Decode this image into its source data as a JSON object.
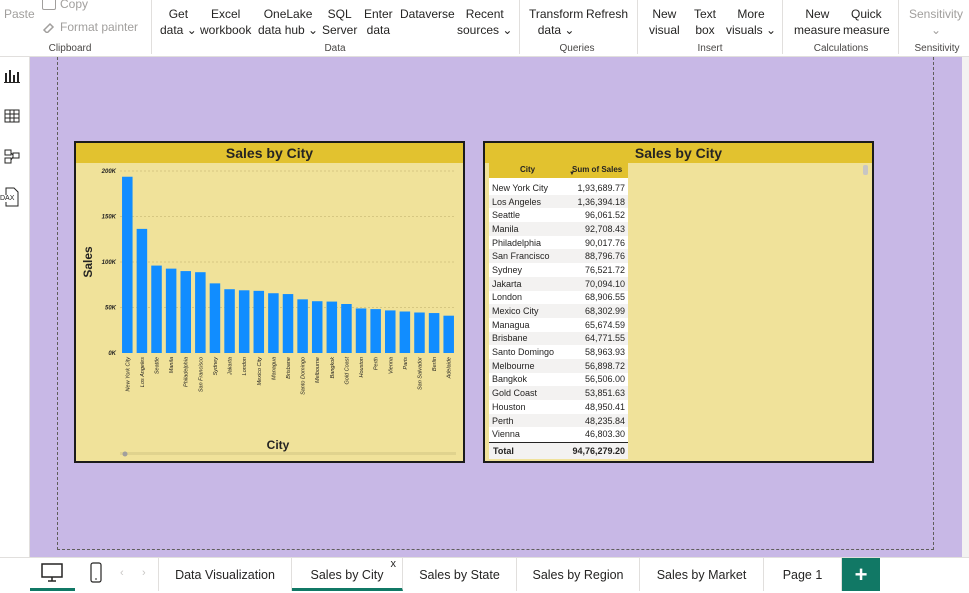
{
  "ribbon": {
    "clipboard": {
      "paste": "Paste",
      "copy": "Copy",
      "format_painter": "Format painter",
      "group": "Clipboard"
    },
    "data": {
      "get_data": [
        "Get",
        "data"
      ],
      "excel": [
        "Excel",
        "workbook"
      ],
      "onelake": [
        "OneLake",
        "data hub"
      ],
      "sql": [
        "SQL",
        "Server"
      ],
      "enter_data": [
        "Enter",
        "data"
      ],
      "dataverse": "Dataverse",
      "recent": [
        "Recent",
        "sources"
      ],
      "group": "Data"
    },
    "queries": {
      "transform": [
        "Transform",
        "data"
      ],
      "refresh": "Refresh",
      "group": "Queries"
    },
    "insert": {
      "new_visual": [
        "New",
        "visual"
      ],
      "text_box": [
        "Text",
        "box"
      ],
      "more_visuals": [
        "More",
        "visuals"
      ],
      "group": "Insert"
    },
    "calculations": {
      "new_measure": [
        "New",
        "measure"
      ],
      "quick_measure": [
        "Quick",
        "measure"
      ],
      "group": "Calculations"
    },
    "sensitivity": {
      "label": "Sensitivity",
      "group": "Sensitivity"
    }
  },
  "left_rail": {
    "icons": [
      "report-view-icon",
      "table-view-icon",
      "model-view-icon",
      "dax-query-icon"
    ],
    "dax_label": "DAX"
  },
  "bar_visual": {
    "title": "Sales by City",
    "chart_data": {
      "type": "bar",
      "title": "Sales by City",
      "xlabel": "City",
      "ylabel": "Sales",
      "ylim": [
        0,
        200000
      ],
      "yticks": [
        "0K",
        "50K",
        "100K",
        "150K",
        "200K"
      ],
      "categories": [
        "New York City",
        "Los Angeles",
        "Seattle",
        "Manila",
        "Philadelphia",
        "San Francisco",
        "Sydney",
        "Jakarta",
        "London",
        "Mexico City",
        "Managua",
        "Brisbane",
        "Santo Domingo",
        "Melbourne",
        "Bangkok",
        "Gold Coast",
        "Houston",
        "Perth",
        "Vienna",
        "Paris",
        "San Salvador",
        "Berlin",
        "Adelaide"
      ],
      "values": [
        193689.77,
        136394.18,
        96061.52,
        92708.43,
        90017.76,
        88796.76,
        76521.72,
        70094.1,
        68906.55,
        68302.99,
        65674.59,
        64771.55,
        58963.93,
        56898.72,
        56506.0,
        53851.63,
        48950.41,
        48235.84,
        46803.3,
        45600.0,
        44500.0,
        43900.0,
        41000.0
      ],
      "bar_color": "#118dff",
      "grid": true
    }
  },
  "table_visual": {
    "title": "Sales by City",
    "headers": [
      "City",
      "Sum of Sales"
    ],
    "rows": [
      [
        "New York City",
        "1,93,689.77"
      ],
      [
        "Los Angeles",
        "1,36,394.18"
      ],
      [
        "Seattle",
        "96,061.52"
      ],
      [
        "Manila",
        "92,708.43"
      ],
      [
        "Philadelphia",
        "90,017.76"
      ],
      [
        "San Francisco",
        "88,796.76"
      ],
      [
        "Sydney",
        "76,521.72"
      ],
      [
        "Jakarta",
        "70,094.10"
      ],
      [
        "London",
        "68,906.55"
      ],
      [
        "Mexico City",
        "68,302.99"
      ],
      [
        "Managua",
        "65,674.59"
      ],
      [
        "Brisbane",
        "64,771.55"
      ],
      [
        "Santo Domingo",
        "58,963.93"
      ],
      [
        "Melbourne",
        "56,898.72"
      ],
      [
        "Bangkok",
        "56,506.00"
      ],
      [
        "Gold Coast",
        "53,851.63"
      ],
      [
        "Houston",
        "48,950.41"
      ],
      [
        "Perth",
        "48,235.84"
      ],
      [
        "Vienna",
        "46,803.30"
      ]
    ],
    "total_label": "Total",
    "total_value": "94,76,279.20"
  },
  "tabs": [
    {
      "label": "Data Visualization",
      "active": false
    },
    {
      "label": "Sales by City",
      "active": true
    },
    {
      "label": "Sales by State",
      "active": false
    },
    {
      "label": "Sales by Region",
      "active": false
    },
    {
      "label": "Sales by Market",
      "active": false
    },
    {
      "label": "Page 1",
      "active": false
    }
  ],
  "tab_close": "x",
  "add_tab": "+",
  "colors": {
    "accent": "#117865",
    "canvas": "#c8b8e6",
    "visual_bg": "#f0e29a",
    "title_bar": "#e2c22f",
    "bar": "#118dff"
  }
}
